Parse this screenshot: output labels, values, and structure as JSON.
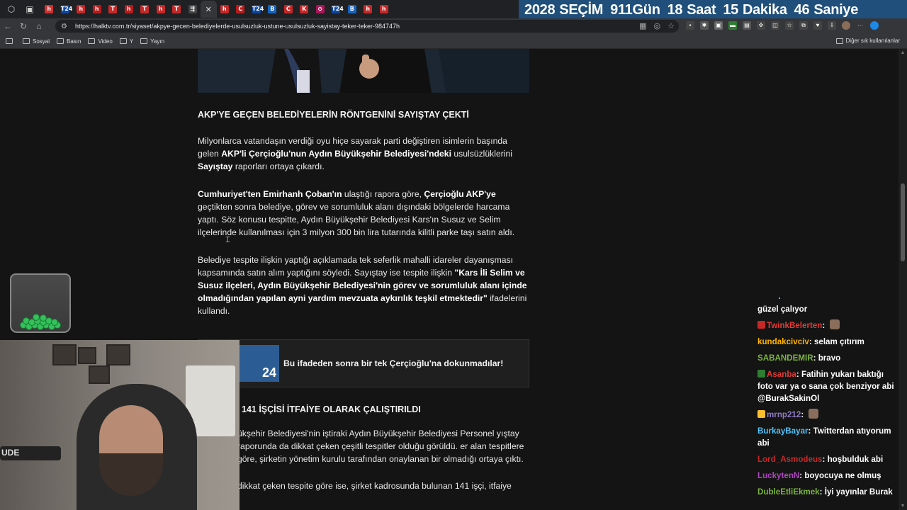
{
  "countdown": {
    "year": "2028",
    "label": "SEÇİM",
    "days_num": "911",
    "days_unit": "Gün",
    "hours_num": "18",
    "hours_unit": "Saat",
    "minutes_num": "15",
    "minutes_unit": "Dakika",
    "seconds_num": "46",
    "seconds_unit": "Saniye"
  },
  "tabs": [
    {
      "letter": "h",
      "color": "#d32f2f"
    },
    {
      "letter": "T24",
      "color": "#0d47a1"
    },
    {
      "letter": "h",
      "color": "#c62828"
    },
    {
      "letter": "h",
      "color": "#b71c1c"
    },
    {
      "letter": "T",
      "color": "#c62828"
    },
    {
      "letter": "h",
      "color": "#b71c1c"
    },
    {
      "letter": "T",
      "color": "#c62828"
    },
    {
      "letter": "h",
      "color": "#c62828"
    },
    {
      "letter": "T",
      "color": "#c62828"
    },
    {
      "letter": "⇶",
      "color": "#444444"
    },
    {
      "letter": "h",
      "color": "#c62828"
    },
    {
      "letter": "C",
      "color": "#b71c1c"
    },
    {
      "letter": "T24",
      "color": "#0d47a1"
    },
    {
      "letter": "B",
      "color": "#1565c0"
    },
    {
      "letter": "C",
      "color": "#c62828"
    },
    {
      "letter": "K",
      "color": "#c62828"
    },
    {
      "letter": "⊙",
      "color": "#ad1457"
    },
    {
      "letter": "T24",
      "color": "#0d47a1"
    },
    {
      "letter": "B",
      "color": "#1565c0"
    },
    {
      "letter": "h",
      "color": "#c62828"
    },
    {
      "letter": "h",
      "color": "#c62828"
    }
  ],
  "omnibox": {
    "url": "https://halktv.com.tr/siyaset/akpye-gecen-belediyelerde-usulsuzluk-ustune-usulsuzluk-sayistay-teker-teker-984747h"
  },
  "bookmarks": {
    "items": [
      "Sosyal",
      "Basın",
      "Video",
      "Y",
      "Yayın"
    ],
    "other": "Diğer sık kullanılanlar"
  },
  "article": {
    "heading": "AKP'YE GEÇEN BELEDİYELERİN RÖNTGENİNİ SAYIŞTAY ÇEKTİ",
    "p1_a": "Milyonlarca vatandaşın verdiği oyu hiçe sayarak parti değiştiren isimlerin başında gelen ",
    "p1_b": "AKP'li Çerçioğlu'nun Aydın Büyükşehir Belediyesi'ndeki",
    "p1_c": " usulsüzlüklerini ",
    "p1_d": "Sayıştay",
    "p1_e": " raporları ortaya çıkardı.",
    "p2_a": "Cumhuriyet'ten Emirhanh Çoban'ın",
    "p2_b": " ulaştığı rapora göre, ",
    "p2_c": "Çerçioğlu AKP'ye",
    "p2_d": " geçtikten sonra belediye, görev ve sorumluluk alanı dışındaki bölgelerde harcama yaptı. Söz konusu tespitte, Aydın Büyükşehir Belediyesi Kars'ın Susuz ve Selim ilçelerinde kullanılması için 3 milyon 300 bin lira tutarında kilitli parke taşı satın aldı.",
    "p3_a": "Belediye tespite ilişkin yaptığı açıklamada tek seferlik mahalli idareler dayanışması kapsamında satın alım yaptığını söyledi. Sayıştay ise tespite ilişkin ",
    "p3_b": "\"Kars İli Selim ve Susuz ilçeleri, Aydın Büyükşehir Belediyesi'nin görev ve sorumluluk alanı içinde olmadığından yapılan ayni yardım mevzuata aykırılık teşkil etmektedir\"",
    "p3_c": " ifadelerini kullandı."
  },
  "related": {
    "logo_text": "24",
    "title": "Bu ifadeden sonra bir tek Çerçioğlu'na dokunmadılar!"
  },
  "article2": {
    "heading": "141 İŞÇİSİ İTFAİYE OLARAK ÇALIŞTIRILDI",
    "p1": "ükşehir Belediyesi'nin iştiraki Aydın Büyükşehir Belediyesi Personel yıştay raporunda da dikkat çeken çeşitli tespitler olduğu görüldü. er alan tespitlere göre, şirketin yönetim kurulu tarafından onaylanan bir olmadığı ortaya çıktı.",
    "p2": "dikkat çeken tespite göre ise, şirket kadrosunda bulunan 141 işçi, itfaiye"
  },
  "webcam": {
    "mic_label": "UDE"
  },
  "chat": [
    {
      "user": "",
      "text": "güzel çalıyor",
      "color": "#ffffff",
      "badge": "",
      "emote": false
    },
    {
      "user": "TwinkBelerten",
      "text": "",
      "color": "#e53935",
      "badge": "#c62828",
      "emote": true
    },
    {
      "user": "kundakcivciv",
      "text": "selam çıtırım",
      "color": "#ffb300",
      "badge": "",
      "emote": false
    },
    {
      "user": "SABANDEMIR",
      "text": "bravo",
      "color": "#7cb342",
      "badge": "",
      "emote": false
    },
    {
      "user": "Asanba",
      "text": "Fatihin yukarı baktığı foto var ya o sana çok benziyor abi @BurakSakinOl",
      "color": "#e53935",
      "badge": "#2e7d32",
      "emote": false
    },
    {
      "user": "mrnp212",
      "text": "",
      "color": "#8e7cc3",
      "badge": "#fbc02d",
      "emote": true
    },
    {
      "user": "BurkayBayar",
      "text": "Twitterdan atıyorum abi",
      "color": "#4fc3f7",
      "badge": "",
      "emote": false
    },
    {
      "user": "Lord_Asmodeus",
      "text": "hoşbulduk abi",
      "color": "#c62828",
      "badge": "",
      "emote": false
    },
    {
      "user": "LuckytenN",
      "text": "boyocuya ne olmuş",
      "color": "#ab47bc",
      "badge": "",
      "emote": false
    },
    {
      "user": "DubleEtliEkmek",
      "text": "İyi yayınlar Burak",
      "color": "#7cb342",
      "badge": "",
      "emote": false
    }
  ]
}
